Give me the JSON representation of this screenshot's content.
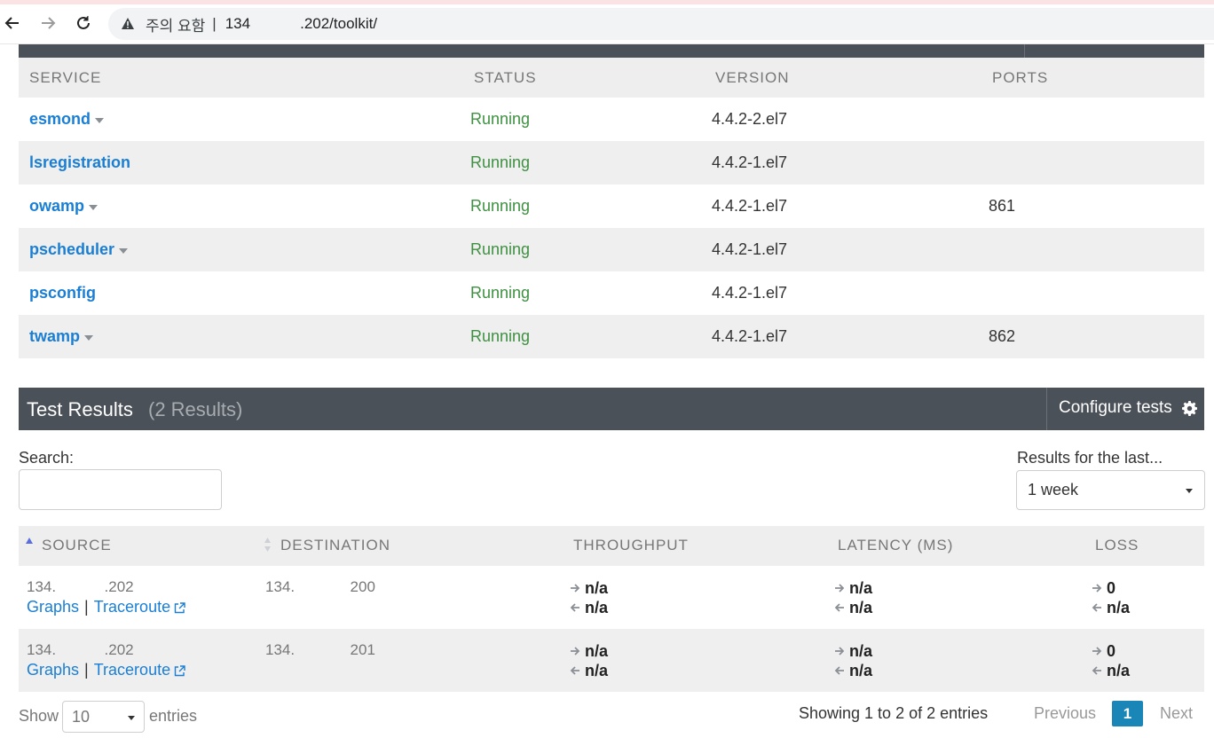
{
  "browser": {
    "warning": "주의 요함",
    "separator": "|",
    "url_host": "134",
    "url_rest": ".202/toolkit/"
  },
  "services": {
    "headers": {
      "service": "SERVICE",
      "status": "STATUS",
      "version": "VERSION",
      "ports": "PORTS"
    },
    "rows": [
      {
        "name": "esmond",
        "status": "Running",
        "version": "4.4.2-2.el7",
        "ports": "",
        "dropdown": true
      },
      {
        "name": "lsregistration",
        "status": "Running",
        "version": "4.4.2-1.el7",
        "ports": "",
        "dropdown": false
      },
      {
        "name": "owamp",
        "status": "Running",
        "version": "4.4.2-1.el7",
        "ports": "861",
        "dropdown": true
      },
      {
        "name": "pscheduler",
        "status": "Running",
        "version": "4.4.2-1.el7",
        "ports": "",
        "dropdown": true
      },
      {
        "name": "psconfig",
        "status": "Running",
        "version": "4.4.2-1.el7",
        "ports": "",
        "dropdown": false
      },
      {
        "name": "twamp",
        "status": "Running",
        "version": "4.4.2-1.el7",
        "ports": "862",
        "dropdown": true
      }
    ]
  },
  "test_results": {
    "title": "Test Results",
    "count": "(2 Results)",
    "configure_label": "Configure tests",
    "search_label": "Search:",
    "search_value": "",
    "range_label": "Results for the last...",
    "range_value": "1 week",
    "headers": {
      "source": "SOURCE",
      "destination": "DESTINATION",
      "throughput": "THROUGHPUT",
      "latency": "LATENCY (MS)",
      "loss": "LOSS"
    },
    "rows": [
      {
        "source_a": "134.",
        "source_b": ".202",
        "dest_a": "134.",
        "dest_b": "200",
        "graphs": "Graphs",
        "pipe": "|",
        "traceroute": "Traceroute",
        "throughput_out": "n/a",
        "throughput_in": "n/a",
        "latency_out": "n/a",
        "latency_in": "n/a",
        "loss_out": "0",
        "loss_in": "n/a"
      },
      {
        "source_a": "134.",
        "source_b": ".202",
        "dest_a": "134.",
        "dest_b": "201",
        "graphs": "Graphs",
        "pipe": "|",
        "traceroute": "Traceroute",
        "throughput_out": "n/a",
        "throughput_in": "n/a",
        "latency_out": "n/a",
        "latency_in": "n/a",
        "loss_out": "0",
        "loss_in": "n/a"
      }
    ]
  },
  "footer": {
    "show_label": "Show",
    "page_size": "10",
    "entries_label": "entries",
    "info": "Showing 1 to 2 of 2 entries",
    "previous": "Previous",
    "current_page": "1",
    "next": "Next"
  },
  "colors": {
    "link": "#1a7fd4",
    "running": "#3f9142",
    "header_dark": "#4b5158",
    "page_active": "#1a86b8"
  }
}
